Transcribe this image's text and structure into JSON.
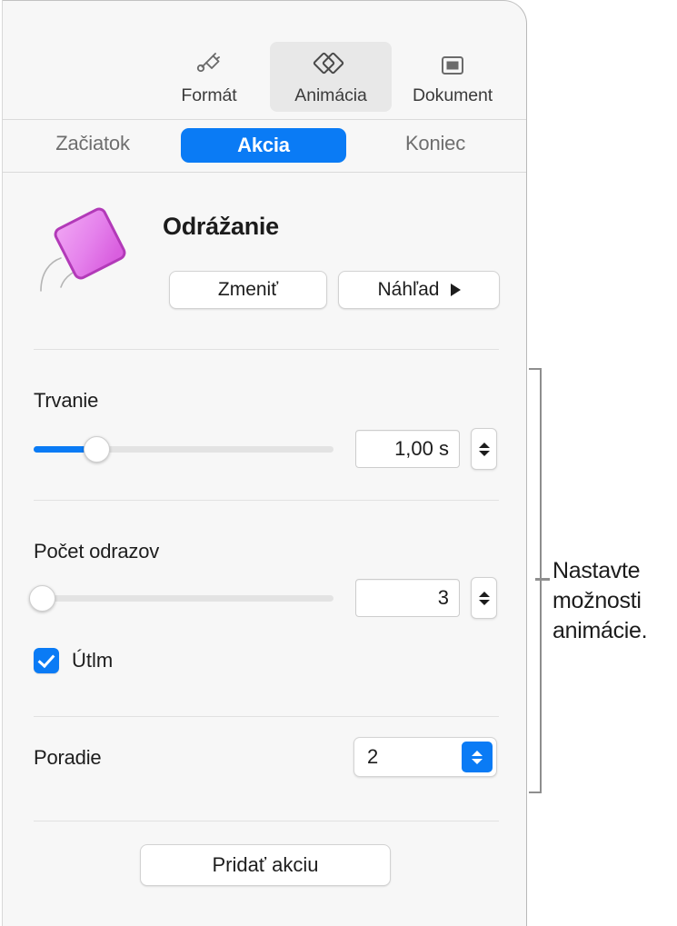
{
  "panel": {
    "accent_color": "#0a7bf5",
    "background_color": "#f7f7f7"
  },
  "tool_tabs": [
    {
      "label": "Formát",
      "icon": "paintbrush-icon",
      "active": false
    },
    {
      "label": "Animácia",
      "icon": "animation-icon",
      "active": true
    },
    {
      "label": "Dokument",
      "icon": "document-icon",
      "active": false
    }
  ],
  "segment_tabs": [
    {
      "label": "Začiatok",
      "active": false
    },
    {
      "label": "Akcia",
      "active": true
    },
    {
      "label": "Koniec",
      "active": false
    }
  ],
  "animation": {
    "name": "Odrážanie",
    "thumbnail_icon": "bouncing-diamond-icon",
    "thumbnail_color": "#e06fe8",
    "change_button": "Zmeniť",
    "preview_button": "Náhľad",
    "preview_icon": "play-icon"
  },
  "duration": {
    "label": "Trvanie",
    "value": "1,00 s",
    "slider_percent": 19,
    "stepper_up_icon": "chevron-up-icon",
    "stepper_down_icon": "chevron-down-icon"
  },
  "bounces": {
    "label": "Počet odrazov",
    "value": "3",
    "slider_percent": 1,
    "stepper_up_icon": "chevron-up-icon",
    "stepper_down_icon": "chevron-down-icon"
  },
  "easing": {
    "label": "Útlm",
    "checked": true,
    "icon": "checkmark-icon"
  },
  "order": {
    "label": "Poradie",
    "value": "2",
    "arrows_icon": "up-down-chevrons-icon"
  },
  "add_action": {
    "label": "Pridať akciu"
  },
  "callout": {
    "text": "Nastavte možnosti animácie.",
    "line_color": "#8e8e8e"
  }
}
